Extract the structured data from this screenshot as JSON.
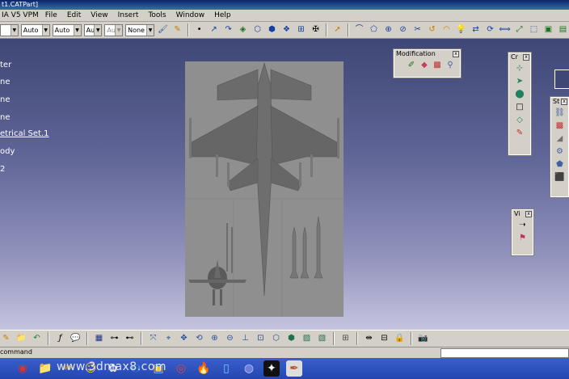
{
  "window": {
    "title": "t1.CATPart]"
  },
  "menubar": {
    "app_label": "IA V5 VPM",
    "items": [
      "File",
      "Edit",
      "View",
      "Insert",
      "Tools",
      "Window",
      "Help"
    ]
  },
  "toolbar": {
    "combos": [
      "",
      "Auto",
      "Auto",
      "Aut",
      "Aut",
      "None"
    ]
  },
  "spec_tree": {
    "items": [
      "ter",
      "ne",
      "ne",
      "ne",
      "etrical Set.1",
      "ody",
      "2"
    ]
  },
  "palettes": {
    "modification": {
      "title": "Modification",
      "close": "x"
    },
    "creation": {
      "title": "Cr",
      "close": "x"
    },
    "styling": {
      "title": "St",
      "close": "x"
    },
    "view": {
      "title": "Vi",
      "close": "x"
    }
  },
  "command": {
    "label": "command",
    "value": ""
  },
  "taskbar": {
    "watermark": "www.3dmax8.com"
  },
  "colors": {
    "viewport_top": "#3e4776",
    "viewport_bottom": "#c5c4de",
    "taskbar": "#2346b0"
  }
}
